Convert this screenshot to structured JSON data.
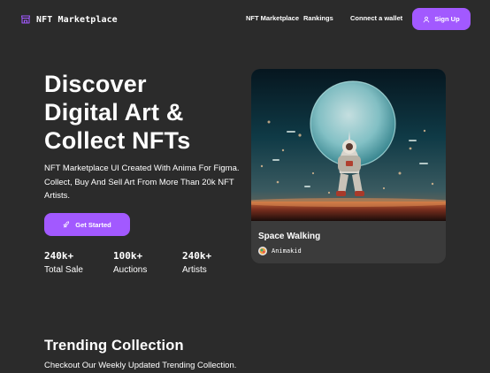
{
  "brand": {
    "name": "NFT Marketplace",
    "icon": "storefront-icon"
  },
  "nav": {
    "links": [
      "NFT Marketplace",
      "Rankings",
      "Connect a wallet"
    ],
    "signup_label": "Sign Up",
    "signup_icon": "user-icon"
  },
  "hero": {
    "title_lines": [
      "Discover",
      "Digital Art &",
      "Collect NFTs"
    ],
    "subtitle": "NFT Marketplace UI Created With Anima For Figma. Collect, Buy And Sell Art From More Than 20k NFT Artists.",
    "cta_label": "Get Started",
    "cta_icon": "rocket-icon",
    "stats": [
      {
        "value": "240k+",
        "label": "Total Sale"
      },
      {
        "value": "100k+",
        "label": "Auctions"
      },
      {
        "value": "240k+",
        "label": "Artists"
      }
    ]
  },
  "featured": {
    "title": "Space Walking",
    "artist": "Animakid"
  },
  "trending": {
    "title": "Trending Collection",
    "subtitle": "Checkout Our Weekly Updated Trending Collection."
  },
  "colors": {
    "background": "#2b2b2b",
    "card": "#3b3b3b",
    "accent": "#a259ff",
    "text": "#ffffff"
  }
}
